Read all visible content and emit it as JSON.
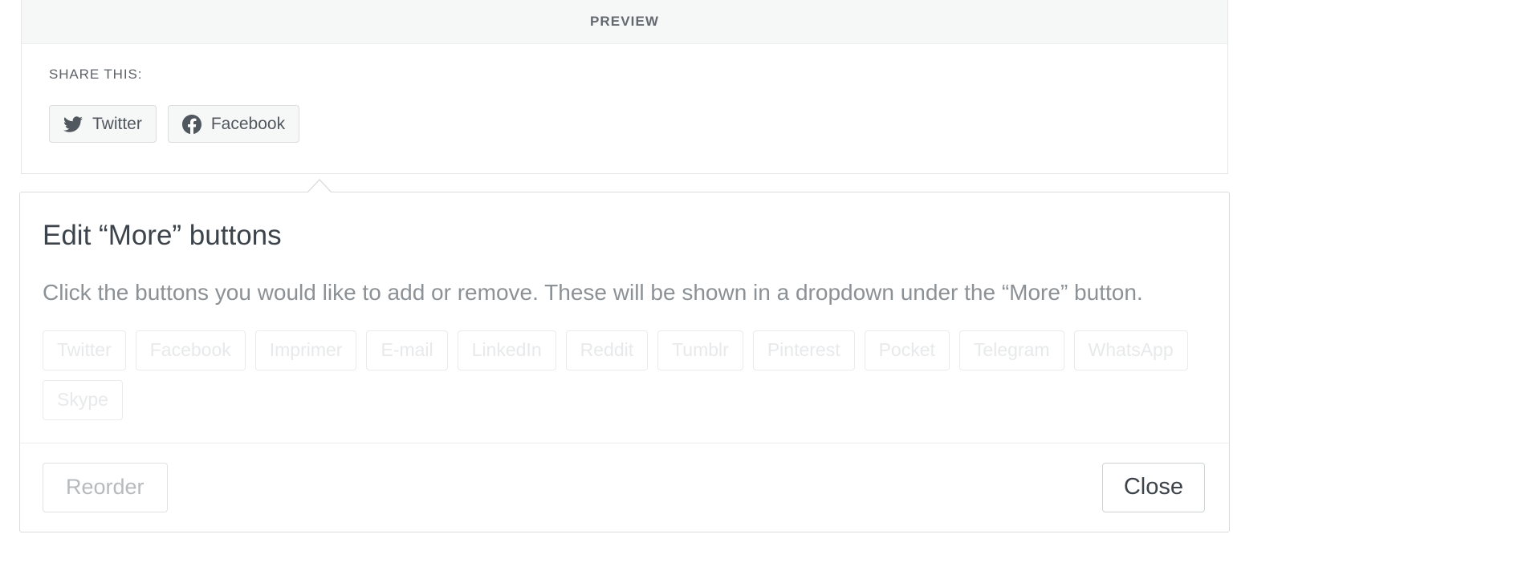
{
  "preview": {
    "header_label": "PREVIEW",
    "share_this_label": "SHARE THIS:",
    "share_buttons": [
      {
        "label": "Twitter",
        "icon": "twitter-icon"
      },
      {
        "label": "Facebook",
        "icon": "facebook-icon"
      }
    ]
  },
  "edit_modal": {
    "title": "Edit “More” buttons",
    "description": "Click the buttons you would like to add or remove. These will be shown in a dropdown under the “More” button.",
    "services": [
      {
        "label": "Twitter"
      },
      {
        "label": "Facebook"
      },
      {
        "label": "Imprimer"
      },
      {
        "label": "E-mail"
      },
      {
        "label": "LinkedIn"
      },
      {
        "label": "Reddit"
      },
      {
        "label": "Tumblr"
      },
      {
        "label": "Pinterest"
      },
      {
        "label": "Pocket"
      },
      {
        "label": "Telegram"
      },
      {
        "label": "WhatsApp"
      },
      {
        "label": "Skype"
      }
    ],
    "footer": {
      "reorder_label": "Reorder",
      "close_label": "Close"
    }
  },
  "colors": {
    "panel_header_bg": "#f6f7f7",
    "border": "#dcdcde",
    "title_text": "#3c434a",
    "muted_text": "#8c9196",
    "disabled_chip_text": "#e8e9ea"
  }
}
